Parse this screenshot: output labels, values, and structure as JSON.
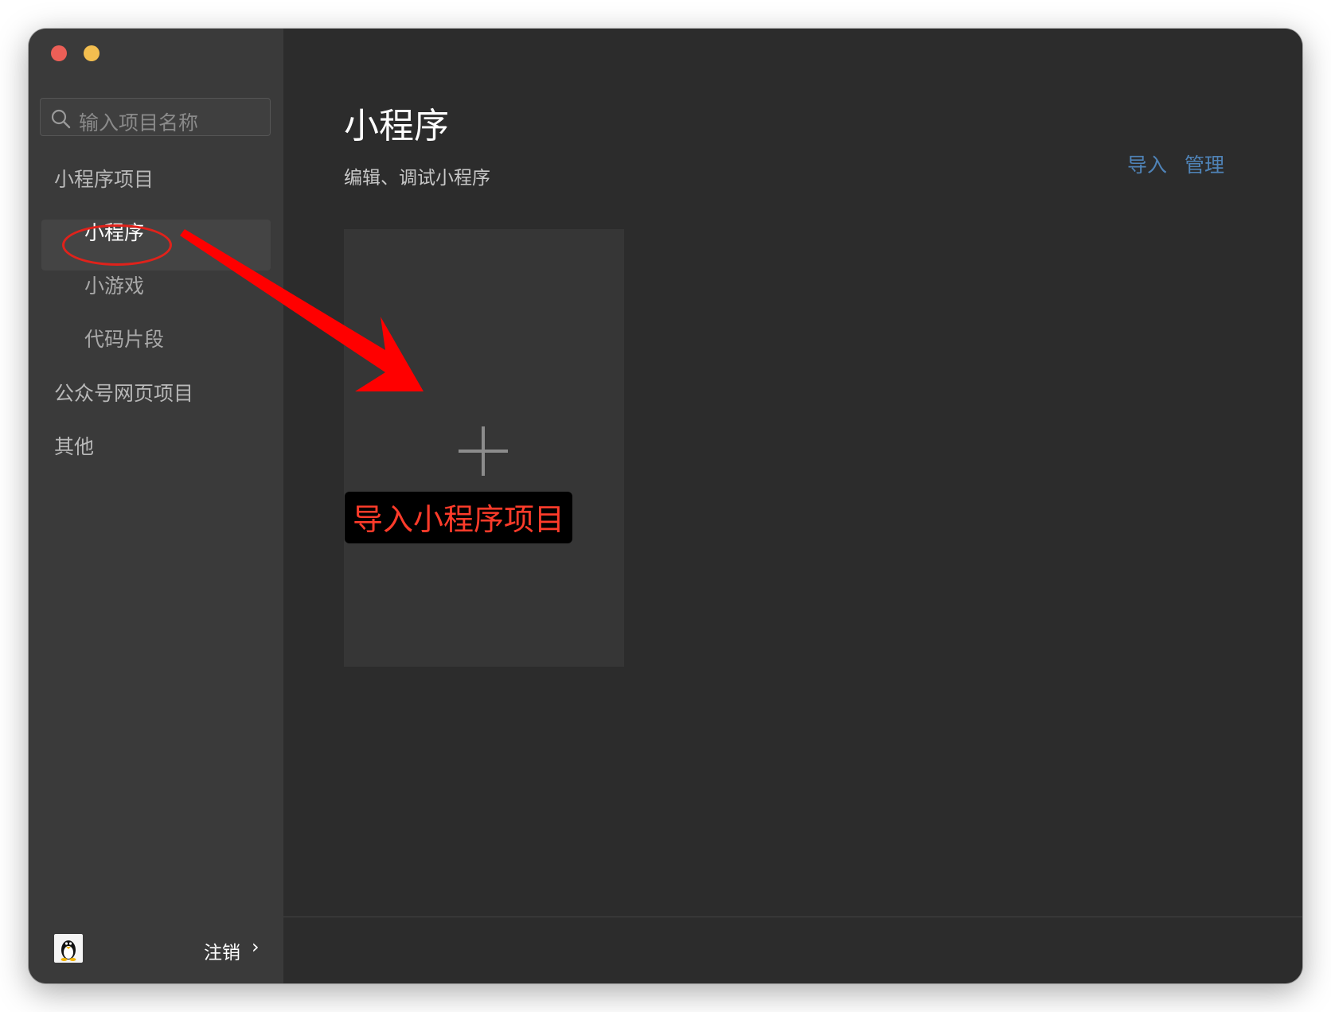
{
  "sidebar": {
    "search": {
      "placeholder": "输入项目名称"
    },
    "groups": [
      {
        "label": "小程序项目"
      },
      {
        "label": "公众号网页项目"
      },
      {
        "label": "其他"
      }
    ],
    "items": [
      {
        "label": "小程序",
        "selected": true
      },
      {
        "label": "小游戏"
      },
      {
        "label": "代码片段"
      }
    ],
    "footer": {
      "logout_label": "注销",
      "arrow": "›"
    }
  },
  "main": {
    "title": "小程序",
    "subtitle": "编辑、调试小程序",
    "links": {
      "import": "导入",
      "manage": "管理"
    },
    "add_card": {
      "callout": "导入小程序项目"
    }
  },
  "colors": {
    "window_bg": "#2c2c2c",
    "sidebar_bg": "#3a3a3a",
    "link": "#4f83b7",
    "annotation_red": "#ff0000",
    "traffic_close": "#ec5f57",
    "traffic_minimize": "#f3be4f"
  }
}
